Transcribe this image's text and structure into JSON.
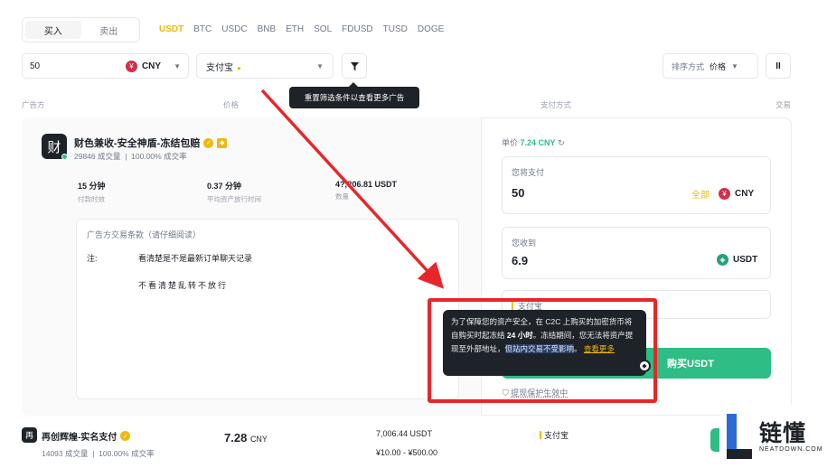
{
  "side_toggle": {
    "buy": "买入",
    "sell": "卖出"
  },
  "coins": [
    "USDT",
    "BTC",
    "USDC",
    "BNB",
    "ETH",
    "SOL",
    "FDUSD",
    "TUSD",
    "DOGE"
  ],
  "active_coin": "USDT",
  "amount_filter": {
    "value": "50",
    "currency_symbol": "¥",
    "currency": "CNY"
  },
  "payment_filter": {
    "value": "支付宝"
  },
  "filter_tooltip": "重置筛选条件以查看更多广告",
  "sort": {
    "label": "排序方式",
    "value": "价格"
  },
  "column_headers": {
    "advertiser": "广告方",
    "price": "价格",
    "payment": "支付方式",
    "trade": "交易"
  },
  "merchant": {
    "avatar_char": "财",
    "name": "财色兼收-安全神盾-冻结包赔",
    "orders": "29846 成交量",
    "completion": "100.00% 成交率",
    "stats": [
      {
        "value": "15 分钟",
        "label": "付款时效"
      },
      {
        "value": "0.37 分钟",
        "label": "平均资产放行时间"
      },
      {
        "value": "4?,?06.81 USDT",
        "label": "数量"
      }
    ]
  },
  "terms": {
    "title": "广告方交易条款（请仔细阅读）",
    "note_label": "注:",
    "line1": "看清楚是不是最新订单聊天记录",
    "line2": "不看清楚乱转不放行"
  },
  "order": {
    "unit_price_label": "单价",
    "unit_price": "7.24 CNY",
    "pay_label": "您将支付",
    "pay_value": "50",
    "all_label": "全部",
    "pay_currency": "CNY",
    "receive_label": "您收到",
    "receive_value": "6.9",
    "receive_currency": "USDT",
    "method_label": "支付宝",
    "buy_button": "购买USDT",
    "protection": "提现保护生效中"
  },
  "protection_tip": {
    "part1": "为了保障您的资产安全，在 C2C 上购买的加密货币将自购买时起冻结 ",
    "bold": "24 小时",
    "part2": "。冻结期间，您无法将资产提现至外部地址，",
    "highlight": "但站内交易不受影响",
    "part3": "。",
    "link": "查看更多"
  },
  "row2": {
    "avatar_char": "再",
    "name": "再创辉煌-实名支付",
    "orders": "14093 成交量",
    "completion": "100.00% 成交率",
    "price": "7.28",
    "price_currency": "CNY",
    "available": "7,006.44 USDT",
    "limit": "¥10.00 - ¥500.00",
    "payment": "支付宝"
  },
  "watermark": {
    "cn": "链懂",
    "en": "NEATDOWN.COM"
  },
  "colors": {
    "accent": "#f0b90b",
    "buy_green": "#2ebd85",
    "annotation_red": "#e8262a"
  }
}
